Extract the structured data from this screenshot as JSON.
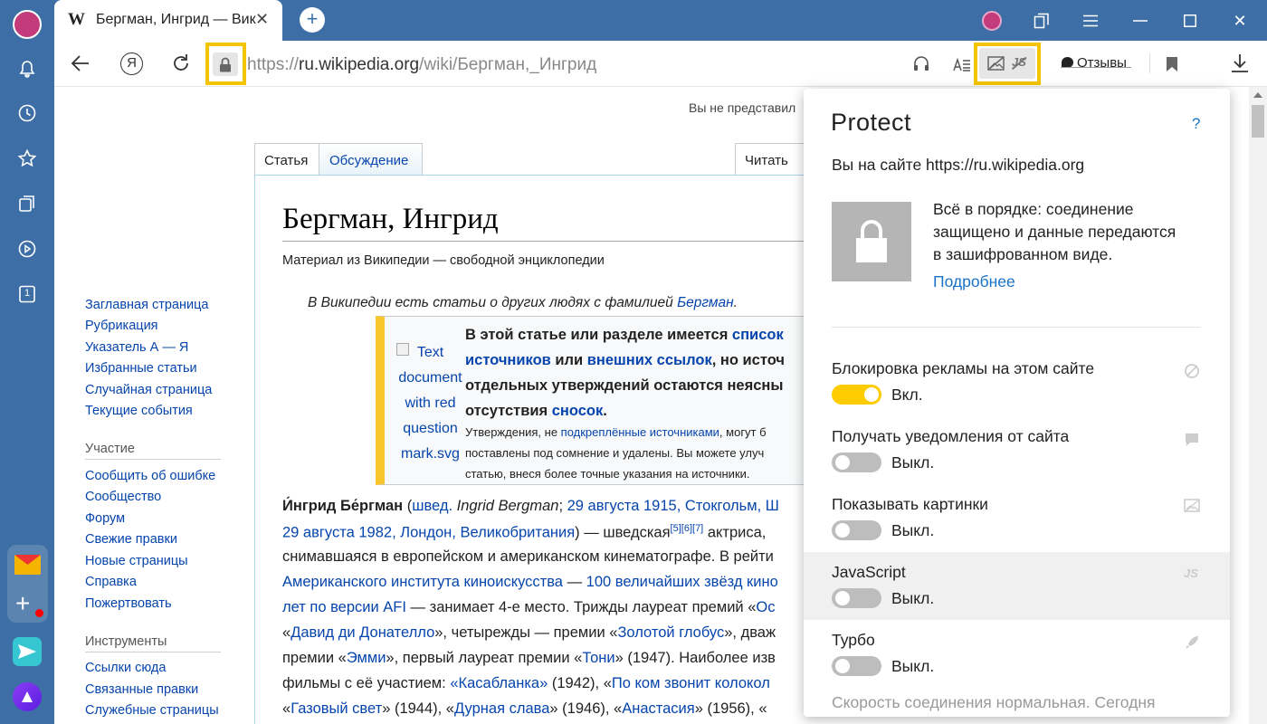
{
  "browser": {
    "tab_title": "Бергман, Ингрид — Вик",
    "tab_favicon": "W",
    "url_scheme": "https://",
    "url_host": "ru.wikipedia.org",
    "url_path": "/wiki/Бергман,_Ингрид",
    "reviews_label": "Отзывы",
    "sidebar_badge": "1",
    "accent": "#f5c400"
  },
  "wiki": {
    "not_logged_in": "Вы не представил",
    "tabs": {
      "article": "Статья",
      "talk": "Обсуждение",
      "read": "Читать"
    },
    "title": "Бергман, Ингрид",
    "subtitle": "Материал из Википедии — свободной энциклопедии",
    "hatnote_prefix": "В Википедии есть статьи о других людях с фамилией ",
    "hatnote_link": "Бергман",
    "hatnote_suffix": ".",
    "nav": [
      "Заглавная страница",
      "Рубрикация",
      "Указатель А — Я",
      "Избранные статьи",
      "Случайная страница",
      "Текущие события"
    ],
    "participation_head": "Участие",
    "participation": [
      "Сообщить об ошибке",
      "Сообщество",
      "Форум",
      "Свежие правки",
      "Новые страницы",
      "Справка",
      "Пожертвовать"
    ],
    "tools_head": "Инструменты",
    "tools": [
      "Ссылки сюда",
      "Связанные правки",
      "Служебные страницы"
    ],
    "notice": {
      "img_alt": [
        "Text",
        "document",
        "with red",
        "question",
        "mark.svg"
      ],
      "bold1a": "В этой статье или разделе имеется ",
      "link1": "список",
      "link2": "источников",
      "bold2a": " или ",
      "link3": "внешних ссылок",
      "bold2b": ", но источ",
      "bold3": "отдельных утверждений остаются неясны",
      "bold4a": "отсутствия ",
      "link4": "сносок",
      "bold4b": ".",
      "small1a": "Утверждения, не ",
      "small1link": "подкреплённые источниками",
      "small1b": ", могут б",
      "small2": "поставлены под сомнение и удалены. Вы можете улуч",
      "small3": "статью, внеся более точные указания на источники."
    },
    "para": {
      "l1_name": "И́нгрид Бе́ргман",
      "l1_a": " (",
      "l1_swed": "швед.",
      "l1_orig": " Ingrid Bergman",
      "l1_b": "; ",
      "l1_date": "29 августа 1915",
      "l1_c": ", ",
      "l1_city": "Стокгольм",
      "l1_d": ", Ш",
      "l2_date": "29 августа 1982",
      "l2_a": ", ",
      "l2_city": "Лондон",
      "l2_b": ", ",
      "l2_country": "Великобритания",
      "l2_c": ") — шведская",
      "l2_refs": "[5][6][7]",
      "l2_d": " актриса,",
      "l3": "снимавшаяся в европейском и американском кинематографе. В рейти",
      "l4_link": "Американского института киноискусства",
      "l4_a": " — ",
      "l4_link2": "100 величайших звёзд кино",
      "l5_link": "лет по версии AFI",
      "l5_a": " — занимает 4-е место. Трижды лауреат премий «",
      "l5_link2": "Ос",
      "l6_a": "«",
      "l6_link": "Давид ди Донателло",
      "l6_b": "», четырежды — премии «",
      "l6_link2": "Золотой глобус",
      "l6_c": "», дваж",
      "l7_a": "премии «",
      "l7_link": "Эмми",
      "l7_b": "», первый лауреат премии «",
      "l7_link2": "Тони",
      "l7_c": "» (1947). Наиболее изв",
      "l8_a": "фильмы с её участием: ",
      "l8_link": "«Касабланка»",
      "l8_b": " (1942), «",
      "l8_link2": "По ком звонит колокол",
      "l9_a": "«",
      "l9_link": "Газовый свет",
      "l9_b": "» (1944), «",
      "l9_link2": "Дурная слава",
      "l9_c": "» (1946), «",
      "l9_link3": "Анастасия",
      "l9_d": "» (1956), «"
    }
  },
  "protect": {
    "title": "Protect",
    "help": "?",
    "site": "Вы на сайте https://ru.wikipedia.org",
    "status_l1": "Всё в порядке: соединение",
    "status_l2": "защищено и данные передаются",
    "status_l3": "в зашифрованном виде.",
    "more": "Подробнее",
    "rows": [
      {
        "label": "Блокировка рекламы на этом сайте",
        "state": "Вкл.",
        "on": true,
        "icon": "block-icon"
      },
      {
        "label": "Получать уведомления от сайта",
        "state": "Выкл.",
        "on": false,
        "icon": "notification-icon"
      },
      {
        "label": "Показывать картинки",
        "state": "Выкл.",
        "on": false,
        "icon": "image-icon"
      },
      {
        "label": "JavaScript",
        "state": "Выкл.",
        "on": false,
        "icon": "javascript-icon"
      },
      {
        "label": "Турбо",
        "state": "Выкл.",
        "on": false,
        "icon": "rocket-icon"
      }
    ],
    "footer": "Скорость соединения нормальная. Сегодня"
  }
}
